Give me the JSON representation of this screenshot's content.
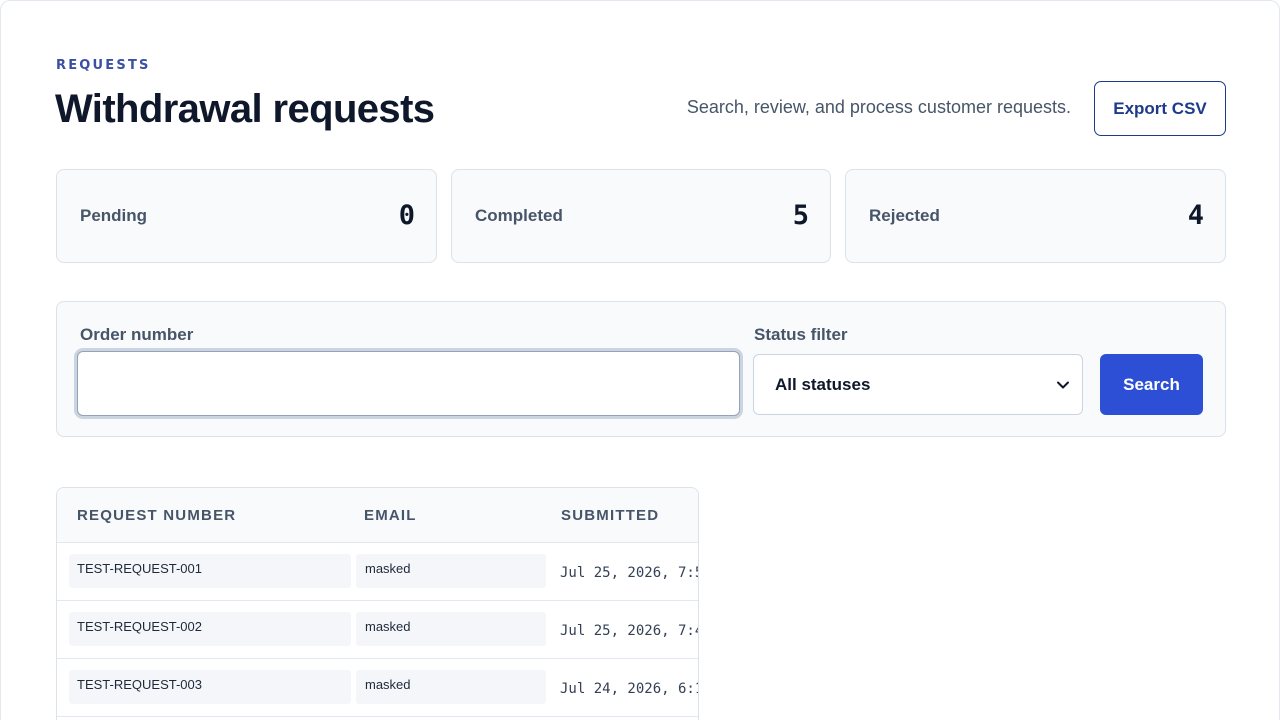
{
  "header": {
    "eyebrow": "REQUESTS",
    "title": "Withdrawal requests",
    "subtitle": "Search, review, and process customer requests.",
    "export_label": "Export CSV"
  },
  "stats": [
    {
      "label": "Pending",
      "value": "0"
    },
    {
      "label": "Completed",
      "value": "5"
    },
    {
      "label": "Rejected",
      "value": "4"
    }
  ],
  "filters": {
    "order_label": "Order number",
    "order_value": "",
    "status_label": "Status filter",
    "status_selected": "All statuses",
    "search_label": "Search"
  },
  "table": {
    "columns": [
      "REQUEST NUMBER",
      "EMAIL",
      "SUBMITTED"
    ],
    "rows": [
      {
        "request_number": "TEST-REQUEST-001",
        "email": "masked",
        "submitted": "Jul 25, 2026, 7:5"
      },
      {
        "request_number": "TEST-REQUEST-002",
        "email": "masked",
        "submitted": "Jul 25, 2026, 7:4"
      },
      {
        "request_number": "TEST-REQUEST-003",
        "email": "masked",
        "submitted": "Jul 24, 2026, 6:1"
      }
    ]
  },
  "colors": {
    "primary": "#2c4fd6",
    "accent_dark": "#1e3a8a",
    "panel_bg": "#f8fafc",
    "border": "#dbe2ea"
  },
  "icons": {
    "select_chevron": "chevron-down-icon"
  }
}
